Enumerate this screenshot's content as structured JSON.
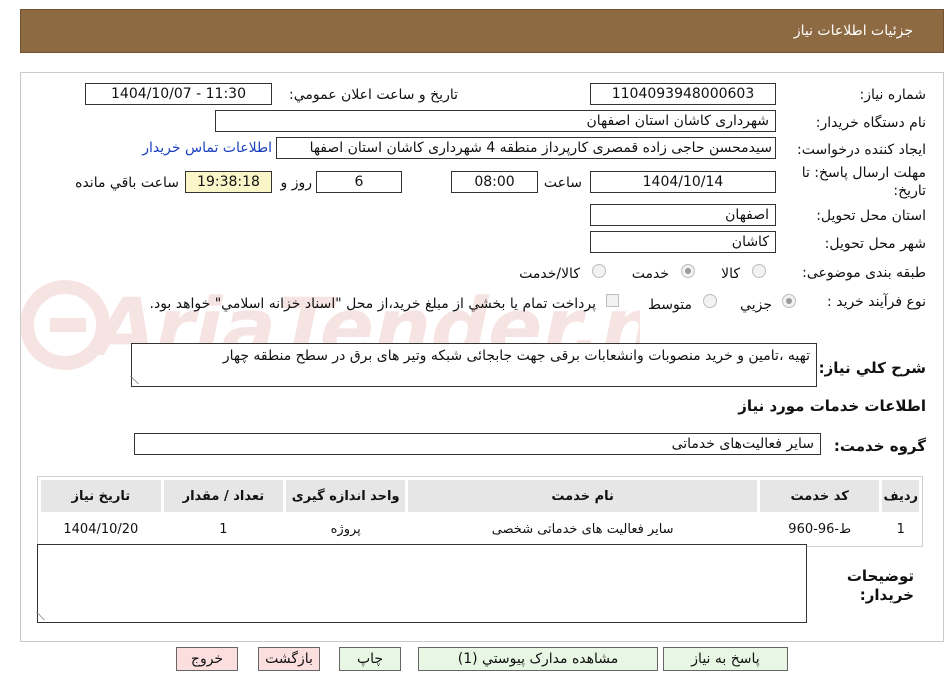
{
  "header": {
    "title": "جزئیات اطلاعات نیاز"
  },
  "fields": {
    "need_number_label": "شماره نیاز:",
    "need_number_value": "1104093948000603",
    "announce_label": "تاریخ و ساعت اعلان عمومي:",
    "announce_value": "1404/10/07 - 11:30",
    "buyer_org_label": "نام دستگاه خريدار:",
    "buyer_org_value": "شهرداری کاشان استان اصفهان",
    "requester_label": "ايجاد کننده درخواست:",
    "requester_value": "سیدمحسن حاجی زاده قمصری کارپرداز منطقه 4 شهرداری کاشان استان اصفها",
    "contact_link": "اطلاعات تماس خريدار",
    "deadline_label_1": "مهلت ارسال پاسخ: تا",
    "deadline_label_2": "تاريخ:",
    "deadline_date": "1404/10/14",
    "time_label": "ساعت",
    "deadline_time": "08:00",
    "days_value": "6",
    "days_label": "روز و",
    "remaining_value": "19:38:18",
    "remaining_label": "ساعت باقي مانده",
    "province_label": "استان محل تحويل:",
    "province_value": "اصفهان",
    "city_label": "شهر محل تحويل:",
    "city_value": "کاشان",
    "category_label": "طبقه بندی موضوعی:",
    "category_options": [
      "کالا",
      "خدمت",
      "کالا/خدمت"
    ],
    "category_selected": "خدمت",
    "process_label": "نوع فرآيند خريد :",
    "process_options": [
      "جزيي",
      "متوسط"
    ],
    "process_selected": "جزيي",
    "payment_note": "پرداخت تمام يا بخشي از مبلغ خريد،از محل \"اسناد خزانه اسلامي\" خواهد بود."
  },
  "description": {
    "label": "شرح کلي نياز:",
    "value": "تهیه ،تامین و خرید منصوبات وانشعابات برقی جهت جابجائی شبکه وتیر های برق در سطح منطقه چهار"
  },
  "services": {
    "section_title": "اطلاعات خدمات مورد نياز",
    "group_label": "گروه خدمت:",
    "group_value": "سایر فعالیت‌های خدماتی",
    "columns": [
      "رديف",
      "کد خدمت",
      "نام خدمت",
      "واحد اندازه گيری",
      "تعداد / مقدار",
      "تاريخ نياز"
    ],
    "rows": [
      [
        "1",
        "ط-96-960",
        "سایر فعالیت های خدماتی شخصی",
        "پروژه",
        "1",
        "1404/10/20"
      ]
    ]
  },
  "buyer_notes": {
    "label_1": "توضيحات",
    "label_2": "خريدار:"
  },
  "buttons": {
    "reply": "پاسخ به نياز",
    "attachments": "مشاهده مدارک پيوستي (1)",
    "print": "چاپ",
    "back": "بازگشت",
    "exit": "خروج"
  },
  "colors": {
    "header_bg": "#8e6a43",
    "remaining_bg": "#fbf6c8",
    "link": "#1a3fbf",
    "green_btn": "#e8f7e4",
    "pink_btn": "#fbdede"
  },
  "watermark_text": "AriaTender.neT"
}
